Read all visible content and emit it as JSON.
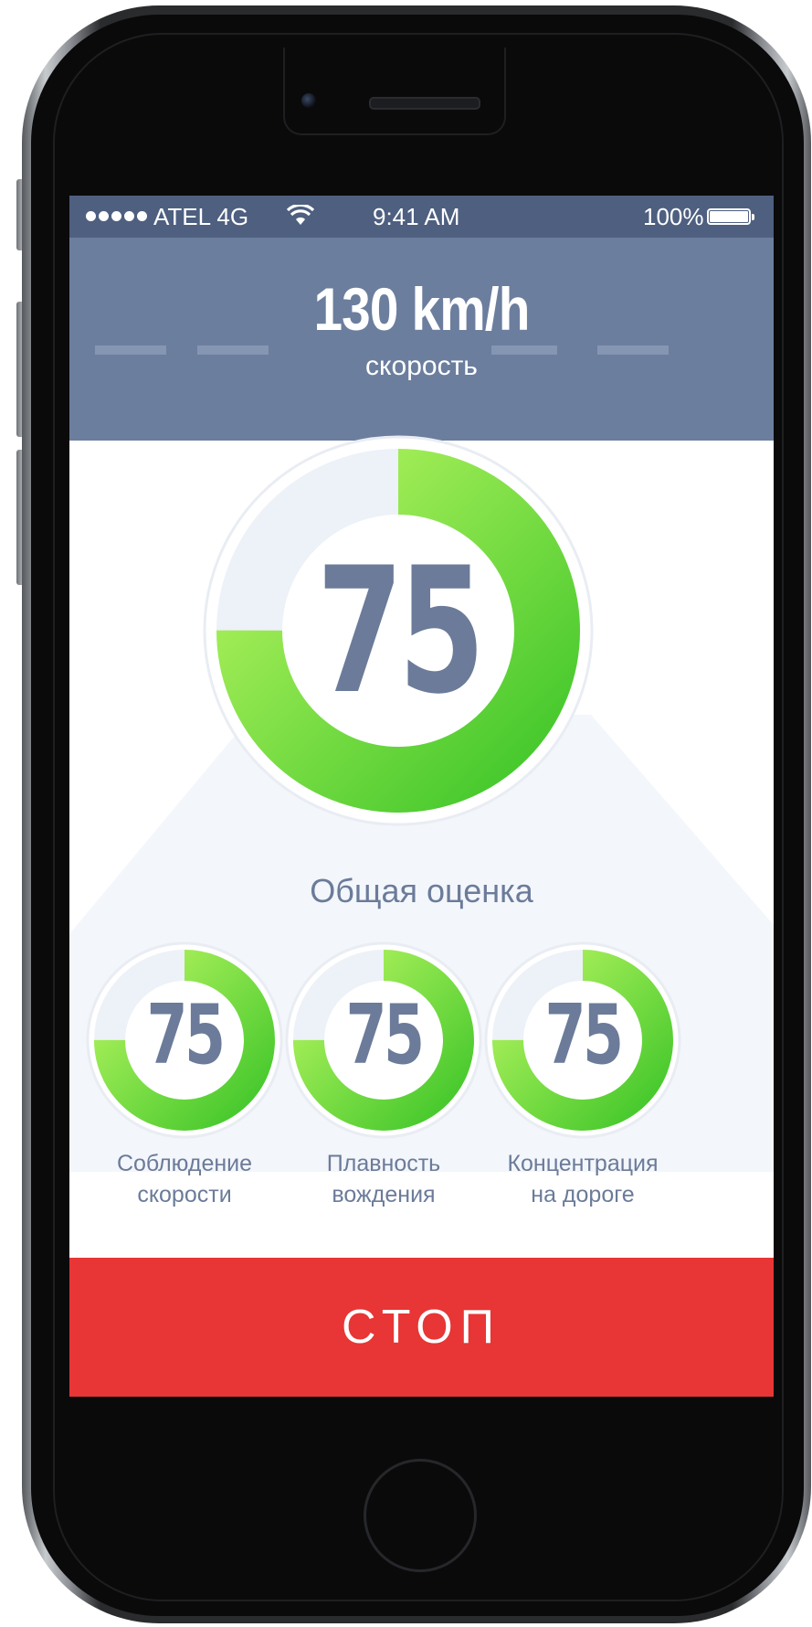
{
  "status_bar": {
    "carrier": "ATEL 4G",
    "time": "9:41 AM",
    "battery": "100%",
    "signal_bars": 5,
    "icons": [
      "signal-dots-icon",
      "wifi-icon",
      "battery-icon"
    ]
  },
  "speed": {
    "value": "130 km/h",
    "label": "скорость"
  },
  "overall": {
    "score": "75",
    "progress": 0.75,
    "label": "Общая оценка"
  },
  "metrics": [
    {
      "score": "75",
      "progress": 0.75,
      "label": "Соблюдение\nскорости"
    },
    {
      "score": "75",
      "progress": 0.75,
      "label": "Плавность\nвождения"
    },
    {
      "score": "75",
      "progress": 0.75,
      "label": "Концентрация\nна дороге"
    }
  ],
  "stop_button": {
    "label": "СТОП"
  },
  "colors": {
    "header": "#6c7e9e",
    "status_bar": "#4e5f80",
    "text": "#6b7b99",
    "ring_start": "#b8f560",
    "ring_end": "#3fc62a",
    "ring_track": "#edf1f8",
    "stop": "#e83535"
  }
}
